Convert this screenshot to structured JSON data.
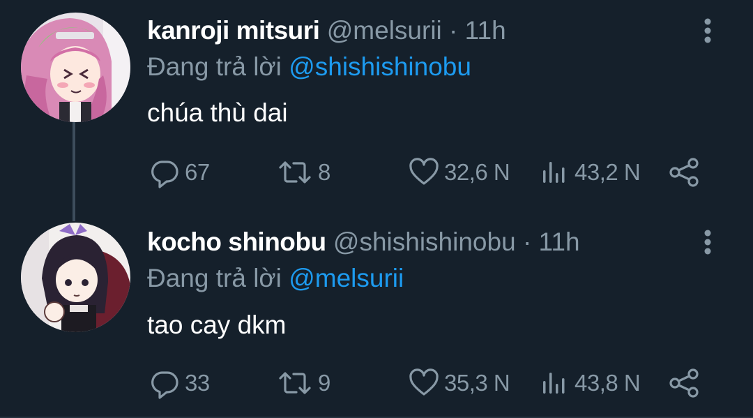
{
  "tweets": [
    {
      "name": "kanroji mitsuri",
      "handle": "@melsurii",
      "dot": "·",
      "time": "11h",
      "reply_prefix": "Đang trả lời",
      "reply_to": "@shishishinobu",
      "text": "chúa thù dai",
      "stats": {
        "replies": "67",
        "retweets": "8",
        "likes": "32,6 N",
        "views": "43,2 N"
      }
    },
    {
      "name": "kocho shinobu",
      "handle": "@shishishinobu",
      "dot": "·",
      "time": "11h",
      "reply_prefix": "Đang trả lời",
      "reply_to": "@melsurii",
      "text": "tao cay dkm",
      "stats": {
        "replies": "33",
        "retweets": "9",
        "likes": "35,3 N",
        "views": "43,8 N"
      }
    }
  ],
  "colors": {
    "background": "#15202b",
    "text_primary": "#ffffff",
    "text_secondary": "#8899a6",
    "mention": "#1d9bf0",
    "thread_line": "#3d4d5c"
  },
  "icons": {
    "reply": "reply-icon",
    "retweet": "retweet-icon",
    "like": "heart-icon",
    "views": "views-icon",
    "share": "share-icon",
    "more": "more-vertical-icon"
  }
}
